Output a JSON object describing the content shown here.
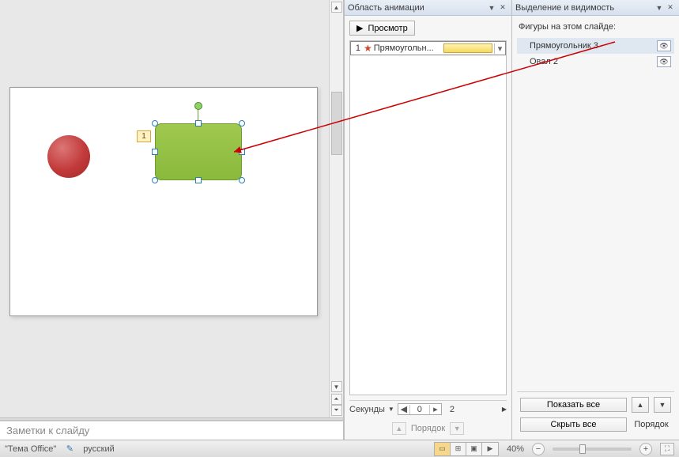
{
  "slide": {
    "anim_tag": "1"
  },
  "notes": {
    "placeholder": "Заметки к слайду"
  },
  "animation_pane": {
    "title": "Область анимации",
    "preview_label": "Просмотр",
    "item": {
      "index": "1",
      "name": "Прямоугольн..."
    },
    "timeline": {
      "label": "Секунды",
      "current": "0",
      "marker": "2"
    },
    "reorder_label": "Порядок"
  },
  "selection_pane": {
    "title": "Выделение и видимость",
    "caption": "Фигуры на этом слайде:",
    "items": [
      {
        "name": "Прямоугольник 3",
        "selected": true
      },
      {
        "name": "Овал 2",
        "selected": false
      }
    ],
    "show_all": "Показать все",
    "hide_all": "Скрыть все",
    "reorder_label": "Порядок"
  },
  "status": {
    "theme": "\"Тема Office\"",
    "language": "русский",
    "zoom": "40%"
  }
}
